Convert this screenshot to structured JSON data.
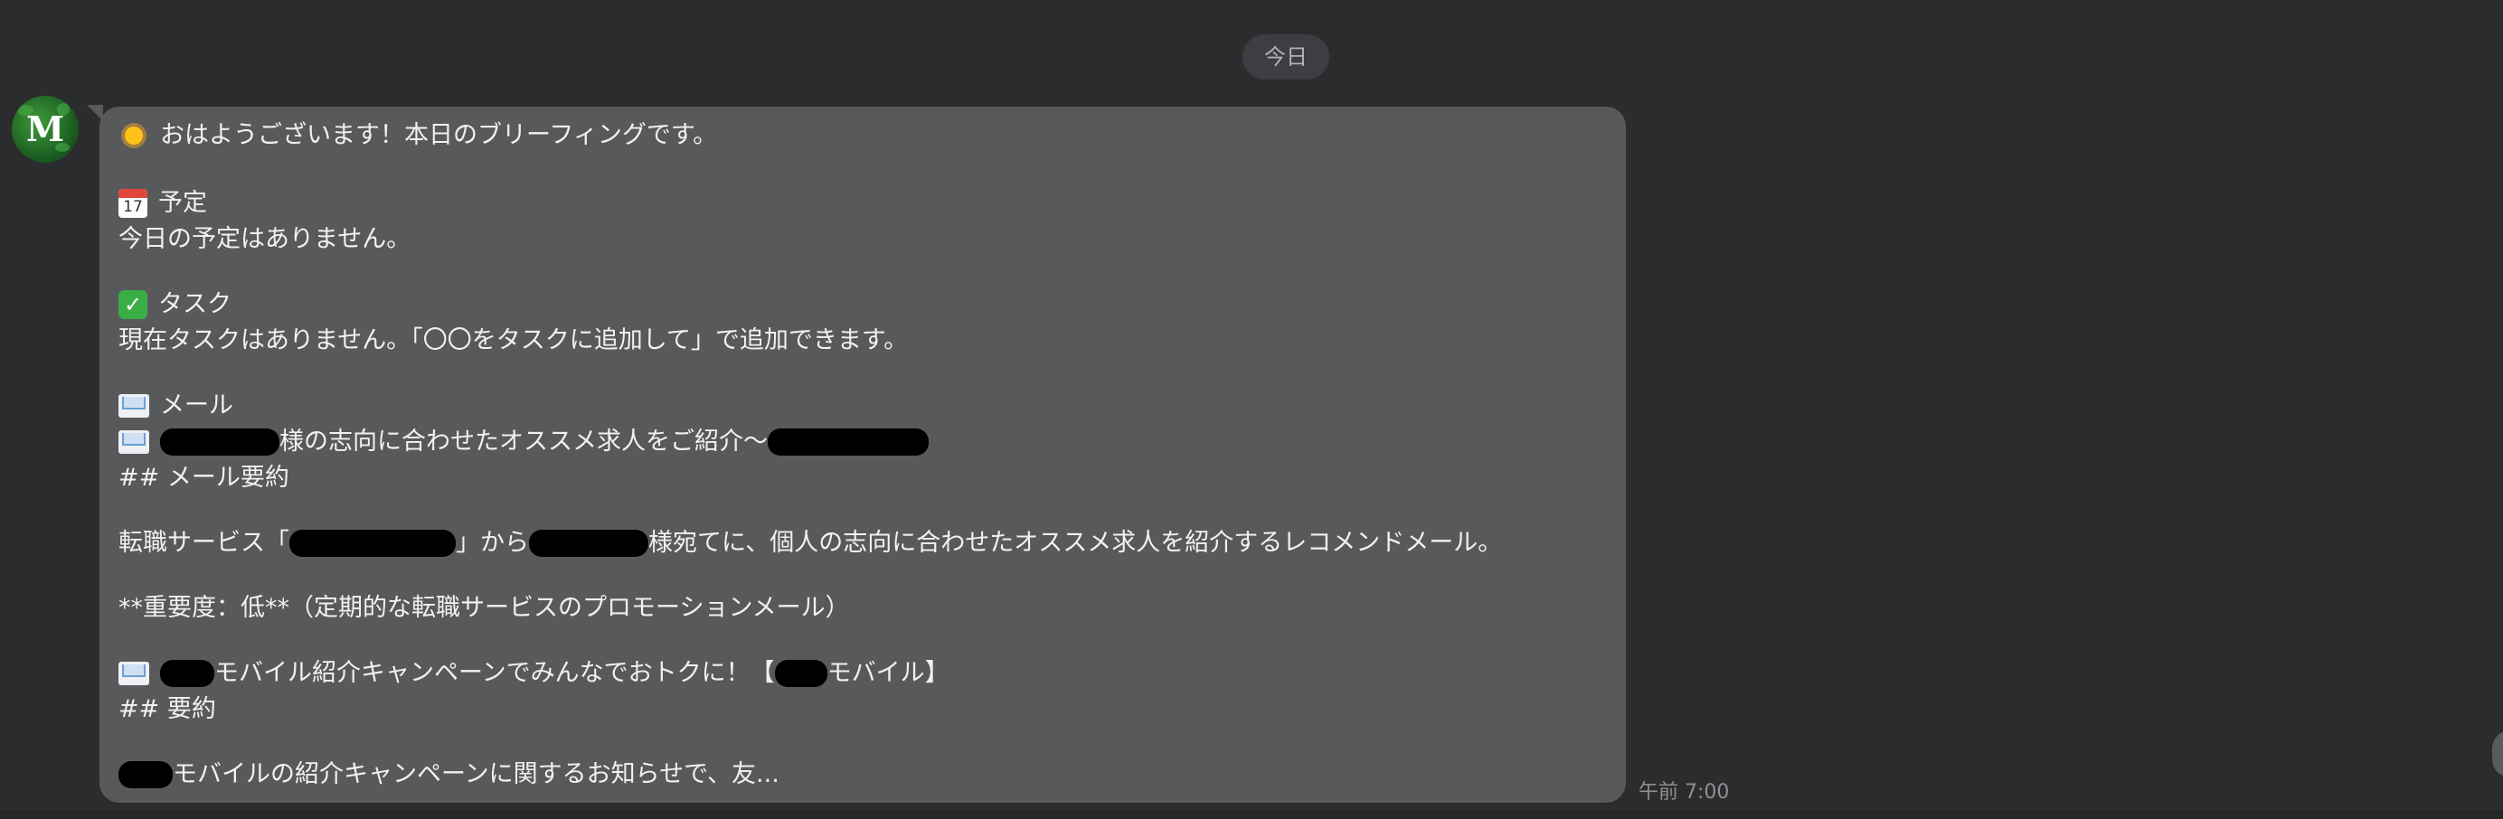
{
  "date_divider": "今日",
  "avatar": {
    "letter": "M",
    "color": "#2a7a2c"
  },
  "message": {
    "greeting": "おはようございます！本日のブリーフィングです。",
    "schedule": {
      "heading": "予定",
      "calendar_day": "17",
      "body": "今日の予定はありません。"
    },
    "tasks": {
      "heading": "タスク",
      "body": "現在タスクはありません。「〇〇をタスクに追加して」で追加できます。"
    },
    "mail": {
      "heading": "メール",
      "item1": {
        "subject_mid": "様の志向に合わせたオススメ求人をご紹介〜",
        "subject_end": "",
        "summary_heading": "## メール要約",
        "summary_prefix": "転職サービス「",
        "summary_mid1": "」から",
        "summary_mid2": "様宛てに、個人の志向に合わせたオススメ求人を紹介するレコメンドメール。",
        "importance": "**重要度：低**（定期的な転職サービスのプロモーションメール）"
      },
      "item2": {
        "subject_mid": "モバイル紹介キャンペーンでみんなでおトクに！【",
        "subject_end": "モバイル】",
        "summary_heading": "## 要約",
        "summary_tail": "モバイルの紹介キャンペーンに関するお知らせで、友..."
      }
    }
  },
  "timestamp": "午前 7:00",
  "icons": {
    "sun": "sun-icon",
    "calendar": "calendar-icon",
    "check": "check-icon",
    "mail": "mail-icon"
  },
  "colors": {
    "background": "#2b2c2e",
    "bubble": "#58595b",
    "text": "#f1f1f1",
    "timestamp": "#8e8f92"
  }
}
